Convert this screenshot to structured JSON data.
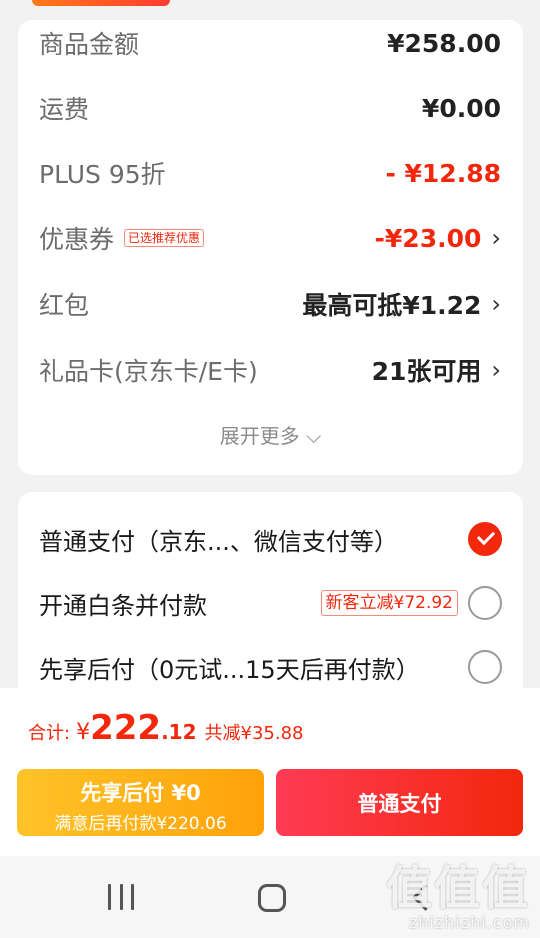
{
  "summary": {
    "rows": [
      {
        "label": "商品金额",
        "value": "¥258.00"
      },
      {
        "label": "运费",
        "value": "¥0.00"
      },
      {
        "label": "PLUS 95折",
        "value": "- ¥12.88"
      },
      {
        "label": "优惠券",
        "tag": "已选推荐优惠",
        "value": "-¥23.00"
      },
      {
        "label": "红包",
        "value": "最高可抵¥1.22"
      },
      {
        "label": "礼品卡(京东卡/E卡)",
        "value": "21张可用"
      }
    ],
    "chevron": "›",
    "expand_more": "展开更多 ⌵"
  },
  "payment": {
    "options": [
      {
        "label": "普通支付（京东...、微信支付等）",
        "selected": true
      },
      {
        "label": "开通白条并付款",
        "promo": "新客立减¥72.92",
        "selected": false
      },
      {
        "label": "先享后付（0元试...15天后再付款）",
        "selected": false
      }
    ]
  },
  "total": {
    "label": "合计:",
    "currency": "¥",
    "amount_int": "222",
    "amount_dec": ".12",
    "saved": "共减¥35.88"
  },
  "actions": {
    "later_main": "先享后付 ¥0",
    "later_sub": "满意后再付款¥220.06",
    "pay": "普通支付"
  },
  "watermark": {
    "big": "值值值",
    "small": "zhizhizhi.com"
  },
  "colors": {
    "accent_red": "#f2270c",
    "accent_orange": "#ffa20a"
  }
}
